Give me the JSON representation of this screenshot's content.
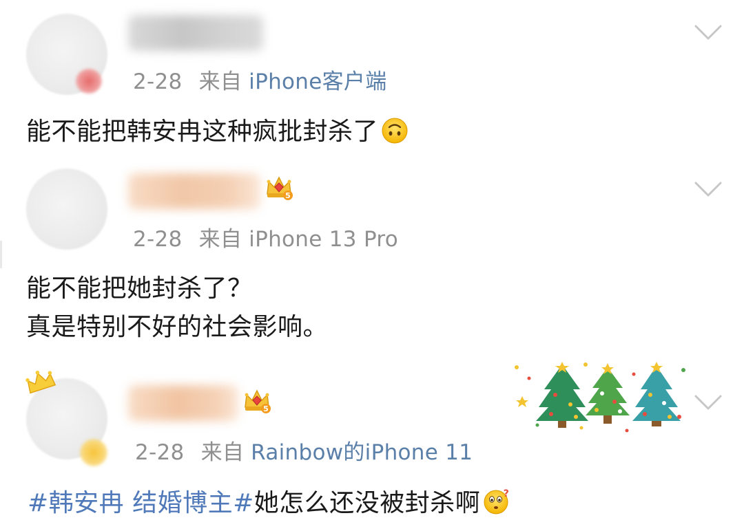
{
  "comments": [
    {
      "meta": {
        "date": "2-28",
        "from_label": "来自",
        "source": "iPhone客户端"
      },
      "text_line1": "能不能把韩安冉这种疯批封杀了",
      "emoji": "upside-down-face"
    },
    {
      "meta": {
        "date": "2-28",
        "from_label": "来自",
        "source": "iPhone 13 Pro"
      },
      "text_line1": "能不能把她封杀了？",
      "text_line2": "真是特别不好的社会影响。",
      "badge_level": "5"
    },
    {
      "meta": {
        "date": "2-28",
        "from_label": "来自",
        "source": "Rainbow的iPhone 11"
      },
      "topic": "#韩安冉 结婚博主#",
      "text_rest": "她怎么还没被封杀啊",
      "emoji": "thinking-face",
      "badge_level": "5"
    }
  ],
  "colors": {
    "text": "#1a1a1a",
    "meta": "#8f8f8f",
    "source_link": "#5a7fa8",
    "topic_link": "#4f79b8",
    "chevron": "#c7c7c7"
  },
  "icons": [
    "chevron-down-icon",
    "crown-level-badge-icon",
    "upside-down-face-emoji",
    "thinking-face-emoji",
    "christmas-trees-decoration"
  ]
}
